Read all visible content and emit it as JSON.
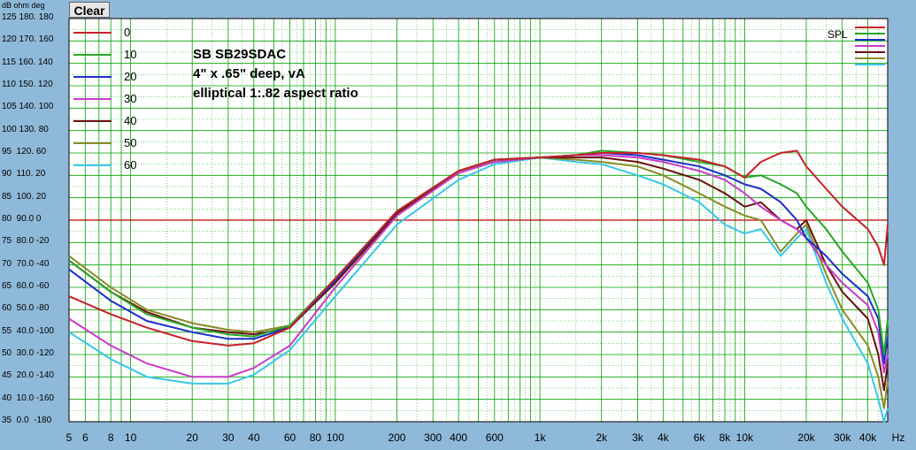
{
  "toolbar": {
    "clear_label": "Clear"
  },
  "axis_header": {
    "units": "dB  ohm  deg"
  },
  "colors": {
    "plot_bg": "#ffffff",
    "frame_bg": "#8fb9d9",
    "grid": "#00a000",
    "reference_line": "#c00000"
  },
  "chart_data": {
    "type": "line",
    "title": "",
    "annotation_lines": [
      "SB SB29SDAC",
      "4\" x .65\" deep, vA",
      "elliptical 1:.82 aspect ratio"
    ],
    "x_scale": "log",
    "xlim": [
      5,
      50000
    ],
    "ylim": [
      35,
      125
    ],
    "x_ticks": [
      {
        "value": 5,
        "label": "5"
      },
      {
        "value": 6,
        "label": "6"
      },
      {
        "value": 8,
        "label": "8"
      },
      {
        "value": 10,
        "label": "10"
      },
      {
        "value": 20,
        "label": "20"
      },
      {
        "value": 30,
        "label": "30"
      },
      {
        "value": 40,
        "label": "40"
      },
      {
        "value": 60,
        "label": "60"
      },
      {
        "value": 80,
        "label": "80"
      },
      {
        "value": 100,
        "label": "100"
      },
      {
        "value": 200,
        "label": "200"
      },
      {
        "value": 300,
        "label": "300"
      },
      {
        "value": 400,
        "label": "400"
      },
      {
        "value": 600,
        "label": "600"
      },
      {
        "value": 1000,
        "label": "1k"
      },
      {
        "value": 2000,
        "label": "2k"
      },
      {
        "value": 3000,
        "label": "3k"
      },
      {
        "value": 4000,
        "label": "4k"
      },
      {
        "value": 6000,
        "label": "6k"
      },
      {
        "value": 8000,
        "label": "8k"
      },
      {
        "value": 10000,
        "label": "10k"
      },
      {
        "value": 20000,
        "label": "20k"
      },
      {
        "value": 30000,
        "label": "30k"
      },
      {
        "value": 40000,
        "label": "40k"
      }
    ],
    "x_unit_label": "Hz",
    "y_ticks": [
      {
        "value": 125,
        "label": "125 180. 180"
      },
      {
        "value": 120,
        "label": "120 170. 160"
      },
      {
        "value": 115,
        "label": "115 160. 140"
      },
      {
        "value": 110,
        "label": "110 150. 120"
      },
      {
        "value": 105,
        "label": "105 140. 100"
      },
      {
        "value": 100,
        "label": "100 130. 80"
      },
      {
        "value": 95,
        "label": "95  120. 60"
      },
      {
        "value": 90,
        "label": "90  110. 20"
      },
      {
        "value": 85,
        "label": "85  100. 20"
      },
      {
        "value": 80,
        "label": "80  90.0 0"
      },
      {
        "value": 75,
        "label": "75  80.0 -20"
      },
      {
        "value": 70,
        "label": "70  70.0 -40"
      },
      {
        "value": 65,
        "label": "65  60.0 -60"
      },
      {
        "value": 60,
        "label": "60  50.0 -80"
      },
      {
        "value": 55,
        "label": "55  40.0 -100"
      },
      {
        "value": 50,
        "label": "50  30.0 -120"
      },
      {
        "value": 45,
        "label": "45  20.0 -140"
      },
      {
        "value": 40,
        "label": "40  10.0 -160"
      },
      {
        "value": 35,
        "label": "35  0.0  -180"
      }
    ],
    "reference_line_y": 80,
    "legend_placement": "top-left",
    "spl_legend": {
      "label": "SPL",
      "placement": "top-right"
    },
    "series": [
      {
        "name": "0",
        "color": "#c8202a",
        "x": [
          5,
          8,
          12,
          20,
          30,
          40,
          60,
          100,
          200,
          400,
          600,
          1000,
          1500,
          2000,
          3000,
          4000,
          6000,
          8000,
          10000,
          12000,
          15000,
          18000,
          20000,
          25000,
          30000,
          40000,
          45000,
          48000,
          50000
        ],
        "y": [
          63,
          59,
          56,
          53,
          52,
          52.5,
          56,
          67,
          82,
          91,
          93.5,
          94,
          94.5,
          95,
          95,
          94.5,
          93.5,
          92,
          89.5,
          93,
          95,
          95.5,
          92,
          87,
          83,
          78,
          74,
          70,
          79
        ]
      },
      {
        "name": "10",
        "color": "#2aa52a",
        "x": [
          5,
          8,
          12,
          20,
          30,
          40,
          60,
          100,
          200,
          400,
          600,
          1000,
          1500,
          2000,
          3000,
          4000,
          6000,
          8000,
          10000,
          12000,
          15000,
          18000,
          20000,
          25000,
          30000,
          40000,
          45000,
          48000,
          50000
        ],
        "y": [
          71,
          64,
          59,
          56,
          54.5,
          54,
          56.5,
          67,
          82,
          91,
          93.5,
          94,
          94.5,
          95.5,
          95,
          94.5,
          93,
          92,
          89.5,
          90,
          88,
          86,
          83,
          78,
          73,
          66,
          60,
          50,
          58
        ]
      },
      {
        "name": "20",
        "color": "#1c2fc8",
        "x": [
          5,
          8,
          12,
          20,
          30,
          40,
          60,
          100,
          200,
          400,
          600,
          1000,
          1500,
          2000,
          3000,
          4000,
          6000,
          8000,
          10000,
          12000,
          15000,
          18000,
          20000,
          25000,
          30000,
          40000,
          45000,
          48000,
          50000
        ],
        "y": [
          69,
          62,
          57.5,
          55,
          53.5,
          53.5,
          56,
          66.5,
          82,
          91,
          93.5,
          94,
          94.5,
          95,
          94.5,
          93.5,
          92,
          90,
          88,
          87,
          84,
          80,
          76,
          72,
          68,
          63,
          58,
          48,
          54
        ]
      },
      {
        "name": "30",
        "color": "#c83ac8",
        "x": [
          5,
          8,
          12,
          20,
          30,
          40,
          60,
          100,
          200,
          400,
          600,
          1000,
          1500,
          2000,
          3000,
          4000,
          6000,
          8000,
          10000,
          12000,
          15000,
          18000,
          20000,
          25000,
          30000,
          40000,
          45000,
          48000,
          50000
        ],
        "y": [
          58,
          52,
          48,
          45,
          45,
          47,
          52,
          65,
          81,
          90.5,
          93,
          94,
          94.5,
          94.5,
          94,
          93,
          91,
          89,
          86,
          83,
          80,
          78,
          76,
          70,
          66,
          61,
          55,
          46,
          50
        ]
      },
      {
        "name": "40",
        "color": "#6b1010",
        "x": [
          5,
          8,
          12,
          20,
          30,
          40,
          60,
          100,
          200,
          400,
          600,
          1000,
          1500,
          2000,
          3000,
          4000,
          6000,
          8000,
          10000,
          12000,
          15000,
          18000,
          20000,
          25000,
          30000,
          40000,
          45000,
          48000,
          50000
        ],
        "y": [
          71,
          64,
          59.5,
          56,
          55,
          54.5,
          56,
          66,
          81.5,
          91,
          93.5,
          94,
          94,
          94,
          93,
          91.5,
          89,
          86,
          83,
          84,
          80,
          78,
          80,
          70,
          64,
          58,
          50,
          42,
          48
        ]
      },
      {
        "name": "50",
        "color": "#8a8a28",
        "x": [
          5,
          8,
          12,
          20,
          30,
          40,
          60,
          100,
          200,
          400,
          600,
          1000,
          1500,
          2000,
          3000,
          4000,
          6000,
          8000,
          10000,
          12000,
          15000,
          18000,
          20000,
          25000,
          30000,
          40000,
          45000,
          48000,
          50000
        ],
        "y": [
          72,
          65,
          60,
          57,
          55.5,
          55,
          56.5,
          66,
          81,
          91,
          93,
          94,
          93.5,
          93,
          92,
          90,
          86,
          83,
          81,
          80,
          73,
          77,
          79,
          68,
          60,
          52,
          45,
          38,
          44
        ]
      },
      {
        "name": "60",
        "color": "#38c8e8",
        "x": [
          5,
          8,
          12,
          20,
          30,
          40,
          60,
          100,
          200,
          400,
          600,
          1000,
          1500,
          2000,
          3000,
          4000,
          6000,
          8000,
          10000,
          12000,
          15000,
          18000,
          20000,
          25000,
          30000,
          40000,
          45000,
          48000,
          50000
        ],
        "y": [
          55,
          49,
          45,
          43.5,
          43.5,
          45.5,
          51,
          63,
          79,
          89,
          92.5,
          94,
          93,
          92.5,
          90,
          88,
          84,
          79,
          77,
          78,
          72,
          76,
          78,
          66,
          58,
          48,
          40,
          35,
          38
        ]
      }
    ]
  }
}
